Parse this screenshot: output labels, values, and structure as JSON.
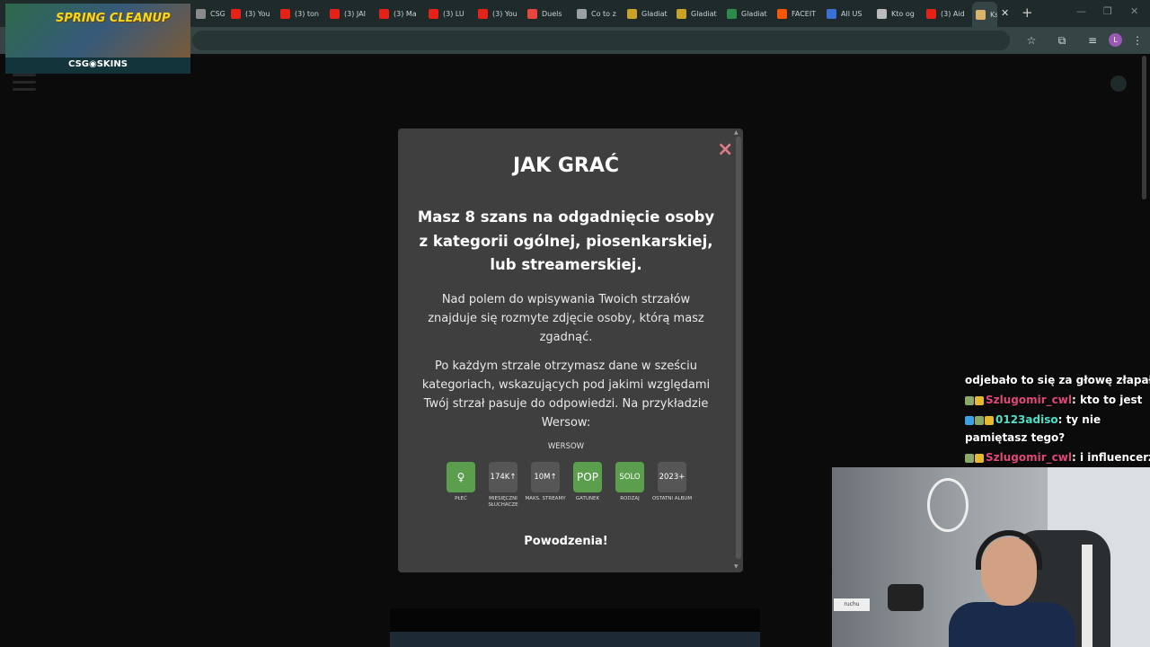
{
  "browser": {
    "tabs": [
      {
        "label": "CSGO-",
        "icon": "csgo-favicon",
        "color": "#8a8a8a"
      },
      {
        "label": "(3) You",
        "icon": "youtube-favicon",
        "color": "#e62117"
      },
      {
        "label": "(3) ton",
        "icon": "youtube-favicon",
        "color": "#e62117"
      },
      {
        "label": "(3) JAI",
        "icon": "youtube-favicon",
        "color": "#e62117"
      },
      {
        "label": "(3) Ma",
        "icon": "youtube-favicon",
        "color": "#e62117"
      },
      {
        "label": "(3) LU",
        "icon": "youtube-favicon",
        "color": "#e62117"
      },
      {
        "label": "(3) You",
        "icon": "youtube-favicon",
        "color": "#e62117"
      },
      {
        "label": "Duels",
        "icon": "map-pin-favicon",
        "color": "#e8453c"
      },
      {
        "label": "Co to z",
        "icon": "cube-favicon",
        "color": "#9aa0a6"
      },
      {
        "label": "Gladiat",
        "icon": "image-favicon",
        "color": "#c9a227"
      },
      {
        "label": "Gladiat",
        "icon": "image-favicon",
        "color": "#c9a227"
      },
      {
        "label": "Gladiat",
        "icon": "slash-favicon",
        "color": "#2c8a4a"
      },
      {
        "label": "FACEIT",
        "icon": "faceit-favicon",
        "color": "#ff5500"
      },
      {
        "label": "All US",
        "icon": "chevron-favicon",
        "color": "#3a6fd8"
      },
      {
        "label": "Kto og",
        "icon": "plus-favicon",
        "color": "#bbbbbb"
      },
      {
        "label": "(3) Aid",
        "icon": "youtube-favicon",
        "color": "#e62117"
      },
      {
        "label": "Ks",
        "icon": "person-favicon",
        "color": "#d9b36a",
        "active": true
      }
    ],
    "close_tab": "✕",
    "new_tab": "+",
    "window_controls": [
      "—",
      "❐",
      "✕"
    ],
    "profile_initial": "L"
  },
  "overlay": {
    "sponsor_title": "SPRING CLEANUP",
    "sponsor_brand": "CSG◉SKINS",
    "chat": [
      {
        "user": "",
        "message": "odjebało to się za głowę złapałem"
      },
      {
        "user": "Szlugomir_cwl",
        "message": ": kto to jest"
      },
      {
        "user": "0123adiso",
        "message": ": ty nie"
      },
      {
        "user": "",
        "message": "pamiętasz tego?"
      },
      {
        "user": "Szlugomir_cwl",
        "message": ": i influencerzy"
      }
    ],
    "webcam_sticker": "ruchu"
  },
  "modal": {
    "close_label": "×",
    "title": "JAK GRAĆ",
    "lead": "Masz 8 szans na odgadnięcie osoby z kategorii ogólnej, piosenkarskiej, lub streamerskiej.",
    "paragraph1": "Nad polem do wpisywania Twoich strzałów znajduje się rozmyte zdjęcie osoby, którą masz zgadnąć.",
    "paragraph2": "Po każdym strzale otrzymasz dane w sześciu kategoriach, wskazujących pod jakimi względami Twój strzał pasuje do odpowiedzi. Na przykładzie Wersow:",
    "example_name": "WERSOW",
    "tiles": [
      {
        "value": "♀",
        "label": "PŁEĆ",
        "status": "match"
      },
      {
        "value": "174K↑",
        "label": "MIESIĘCZNI SŁUCHACZE",
        "status": "miss"
      },
      {
        "value": "10M↑",
        "label": "MAKS. STREAMY",
        "status": "miss"
      },
      {
        "value": "POP",
        "label": "GATUNEK",
        "status": "match"
      },
      {
        "value": "SOLO",
        "label": "RODZAJ",
        "status": "match"
      },
      {
        "value": "2023+",
        "label": "OSTATNI ALBUM",
        "status": "miss"
      }
    ],
    "good_luck": "Powodzenia!"
  },
  "colors": {
    "match": "#5a9e4e",
    "miss": "#565656",
    "close": "#e07b88",
    "modal_bg": "#3f3f3f"
  }
}
